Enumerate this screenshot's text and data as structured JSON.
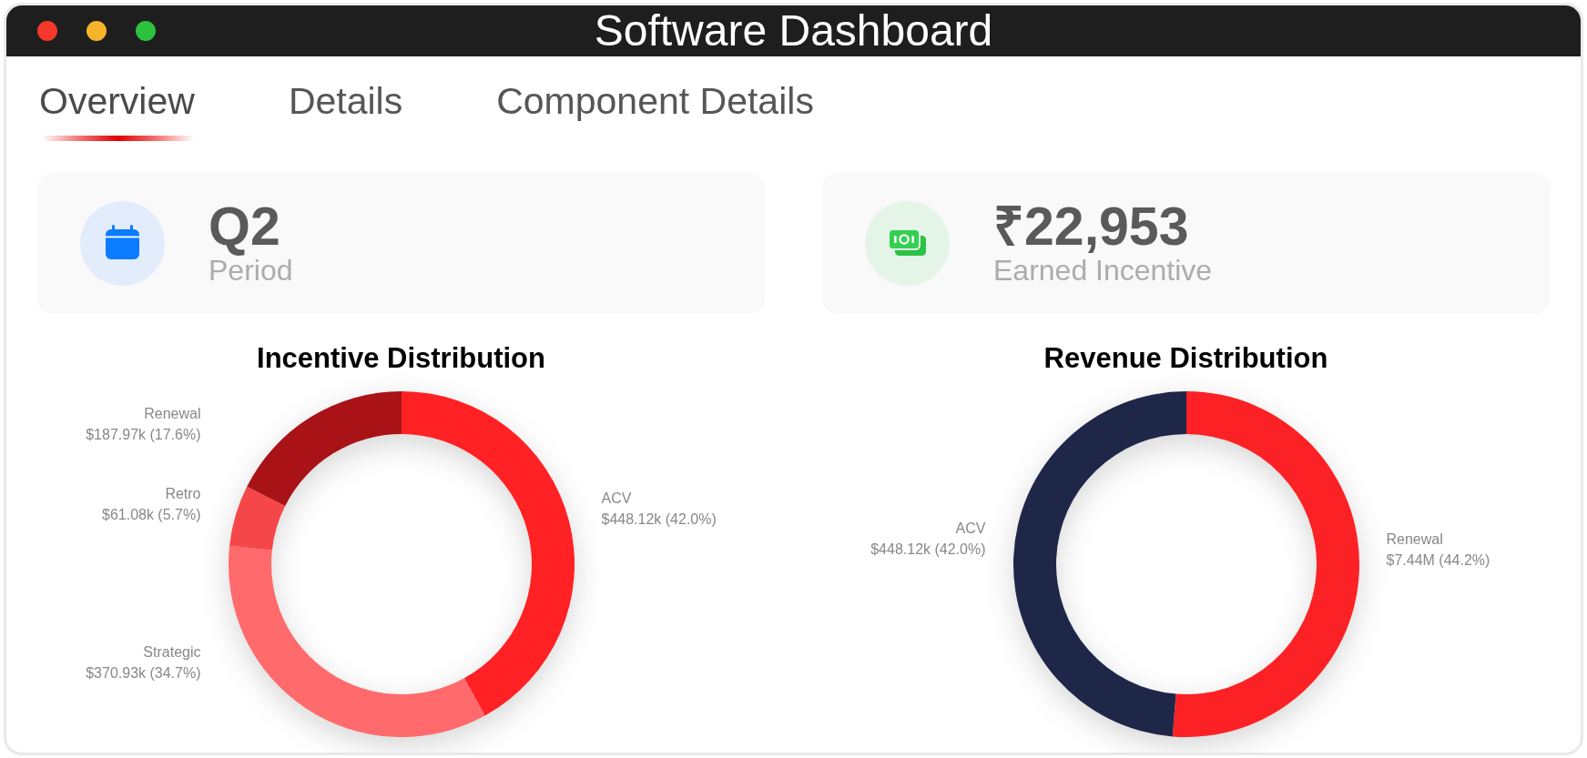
{
  "window": {
    "title": "Software Dashboard"
  },
  "tabs": [
    {
      "label": "Overview",
      "selected": true
    },
    {
      "label": "Details",
      "selected": false
    },
    {
      "label": "Component Details",
      "selected": false
    }
  ],
  "stats": [
    {
      "kind": "calendar",
      "value": "Q2",
      "label": "Period"
    },
    {
      "kind": "money",
      "value": "₹22,953",
      "label": "Earned Incentive"
    }
  ],
  "charts": [
    {
      "chart_data": {
        "type": "donut",
        "title": "Incentive Distribution",
        "categories": [
          "ACV",
          "Strategic",
          "Retro",
          "Renewal"
        ],
        "values": [
          42.0,
          34.7,
          5.7,
          17.6
        ],
        "colors": [
          "#ff2124",
          "#ff6a6c",
          "#f5474a",
          "#a91217"
        ],
        "value_labels": [
          "$448.12k (42.0%)",
          "$370.93k (34.7%)",
          "$61.08k (5.7%)",
          "$187.97k (17.6%)"
        ]
      }
    },
    {
      "chart_data": {
        "type": "donut",
        "title": "Revenue Distribution",
        "categories": [
          "Renewal",
          "ACV"
        ],
        "values": [
          44.2,
          42.0
        ],
        "colors": [
          "#fc2125",
          "#1f2749"
        ],
        "value_labels": [
          "$7.44M (44.2%)",
          "$448.12k (42.0%)"
        ]
      }
    }
  ]
}
